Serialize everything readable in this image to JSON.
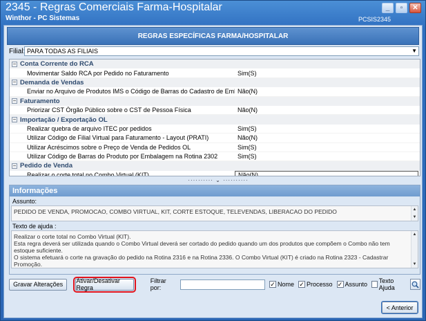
{
  "window": {
    "title": "2345 - Regras Comerciais Farma-Hospitalar",
    "subtitle": "Winthor - PC Sistemas",
    "code": "PCSIS2345",
    "controls": {
      "minimize": "_",
      "restore": "▫",
      "close": "✕"
    }
  },
  "section_header": "REGRAS ESPECÍFICAS FARMA/HOSPITALAR",
  "filial": {
    "label": "Filial:",
    "value": "PARA TODAS AS FILIAIS"
  },
  "categories": [
    {
      "title": "Conta Corrente do RCA",
      "items": [
        {
          "name": "Movimentar Saldo RCA por Pedido no Faturamento",
          "value": "Sim(S)"
        }
      ]
    },
    {
      "title": "Demanda de Vendas",
      "items": [
        {
          "name": "Enviar no Arquivo de Produtos IMS o Código de Barras do Cadastro de Embalagens",
          "value": "Não(N)"
        }
      ]
    },
    {
      "title": "Faturamento",
      "items": [
        {
          "name": "Priorizar CST Órgão Público sobre o CST de Pessoa Física",
          "value": "Não(N)"
        }
      ]
    },
    {
      "title": "Importação / Exportação OL",
      "items": [
        {
          "name": "Realizar quebra de arquivo ITEC por pedidos",
          "value": "Sim(S)"
        },
        {
          "name": "Utilizar Código de Filial Virtual para Faturamento - Layout (PRATI)",
          "value": "Não(N)"
        },
        {
          "name": "Utilizar Acréscimos sobre o Preço de Venda de Pedidos OL",
          "value": "Sim(S)"
        },
        {
          "name": "Utilizar Código de Barras do Produto por Embalagem na Rotina 2302",
          "value": "Sim(S)"
        }
      ]
    },
    {
      "title": "Pedido de Venda",
      "items": [
        {
          "name": "Realizar o corte total no Combo Virtual (KIT)",
          "value": "Não(N)",
          "selected": true
        }
      ]
    }
  ],
  "info": {
    "header": "Informações",
    "assunto_label": "Assunto:",
    "assunto_text": "PEDIDO DE VENDA, PROMOCAO, COMBO VIRTUAL, KIT, CORTE ESTOQUE, TELEVENDAS, LIBERACAO DO PEDIDO",
    "ajuda_label": "Texto de ajuda :",
    "ajuda_lines": [
      "Realizar o corte total no Combo Virtual (KIT).",
      "Esta regra deverá ser utilizada quando o Combo Virtual deverá ser cortado do pedido quando um dos produtos que compõem o Combo não tem estoque suficiente.",
      "O sistema efetuará o corte na gravação do pedido na Rotina 2316 e na Rotina 2336. O Combo Virtual (KIT) é criado na Rotina 2323 - Cadastrar Promoção."
    ]
  },
  "toolbar": {
    "save_label": "Gravar Alterações",
    "toggle_label": "Ativar/Desativar Regra",
    "filter_label": "Filtrar por:",
    "filter_value": "",
    "checks": [
      {
        "label": "Nome",
        "checked": true
      },
      {
        "label": "Processo",
        "checked": true
      },
      {
        "label": "Assunto",
        "checked": true
      },
      {
        "label": "Texto Ajuda",
        "checked": false
      }
    ]
  },
  "back_label": "< Anterior"
}
